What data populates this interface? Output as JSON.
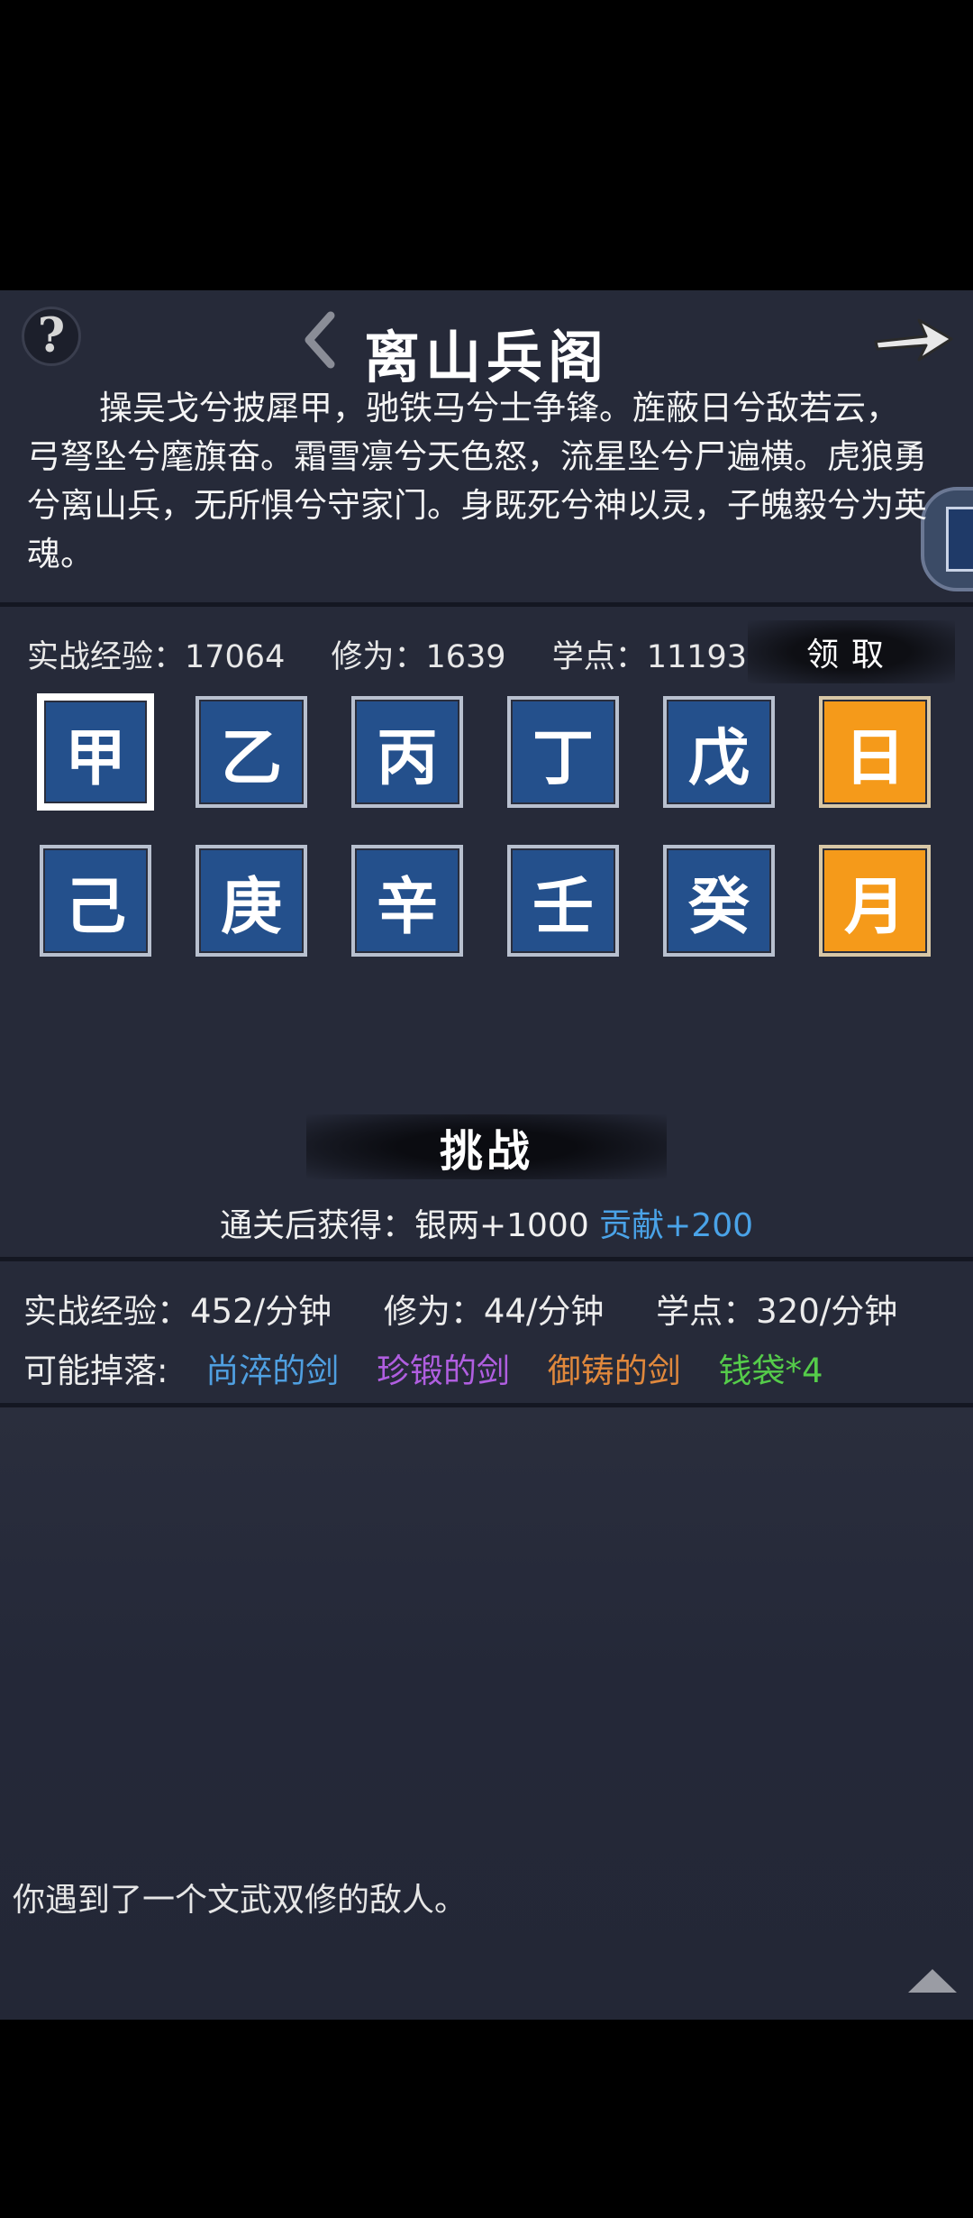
{
  "header": {
    "title": "离山兵阁",
    "help_glyph": "?"
  },
  "poem": "操吴戈兮披犀甲，驰铁马兮士争锋。旌蔽日兮敌若云，弓弩坠兮麾旗奋。霜雪凛兮天色怒，流星坠兮尸遍横。虎狼勇兮离山兵，无所惧兮守家门。身既死兮神以灵，子魄毅兮为英魂。",
  "stats": {
    "exp": "实战经验：17064",
    "cultivation": "修为：1639",
    "points": "学点：11193",
    "claim_label": "领取"
  },
  "tiles": [
    {
      "label": "甲",
      "color": "blue",
      "selected": true
    },
    {
      "label": "乙",
      "color": "blue"
    },
    {
      "label": "丙",
      "color": "blue"
    },
    {
      "label": "丁",
      "color": "blue"
    },
    {
      "label": "戊",
      "color": "blue"
    },
    {
      "label": "日",
      "color": "gold"
    },
    {
      "label": "己",
      "color": "blue"
    },
    {
      "label": "庚",
      "color": "blue"
    },
    {
      "label": "辛",
      "color": "blue"
    },
    {
      "label": "壬",
      "color": "blue"
    },
    {
      "label": "癸",
      "color": "blue"
    },
    {
      "label": "月",
      "color": "gold"
    }
  ],
  "challenge": {
    "label": "挑战",
    "reward_prefix": "通关后获得：银两+1000 ",
    "reward_contribution": "贡献+200"
  },
  "rates": {
    "exp": "实战经验：452/分钟",
    "cultivation": "修为：44/分钟",
    "points": "学点：320/分钟"
  },
  "drops": {
    "label": "可能掉落:",
    "items": [
      {
        "name": "尚淬的剑",
        "color": "#4f9fe0"
      },
      {
        "name": "珍锻的剑",
        "color": "#b05ee0"
      },
      {
        "name": "御铸的剑",
        "color": "#e0883c"
      },
      {
        "name": "钱袋*4",
        "color": "#55cc4a"
      }
    ]
  },
  "log": {
    "message": "你遇到了一个文武双修的敌人。"
  },
  "colors": {
    "panel_bg": "#262a39",
    "tile_blue": "#24508c",
    "tile_gold": "#f59a1a",
    "accent_blue": "#4aa3e8"
  }
}
